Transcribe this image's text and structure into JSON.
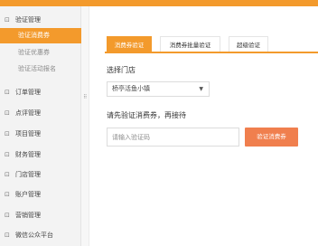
{
  "sidebar": {
    "groups": [
      {
        "icon": "collapse-icon",
        "label": "验证管理",
        "subitems": [
          {
            "label": "验证消费券",
            "active": true
          },
          {
            "label": "验证优惠券",
            "active": false
          },
          {
            "label": "验证活动报名",
            "active": false
          }
        ]
      },
      {
        "icon": "expand-icon",
        "label": "订单管理"
      },
      {
        "icon": "expand-icon",
        "label": "点评管理"
      },
      {
        "icon": "expand-icon",
        "label": "项目管理"
      },
      {
        "icon": "expand-icon",
        "label": "财务管理"
      },
      {
        "icon": "expand-icon",
        "label": "门店管理"
      },
      {
        "icon": "expand-icon",
        "label": "账户管理"
      },
      {
        "icon": "expand-icon",
        "label": "营销管理"
      },
      {
        "icon": "expand-icon",
        "label": "微信公众平台"
      }
    ]
  },
  "tabs": [
    {
      "label": "消费券验证",
      "active": true
    },
    {
      "label": "消费券批量验证",
      "active": false
    },
    {
      "label": "超级验证",
      "active": false
    }
  ],
  "form": {
    "store_label": "选择门店",
    "store_selected": "桥亭活鱼小镇",
    "code_label": "请先验证消费券，再接待",
    "code_placeholder": "请输入验证码",
    "verify_button": "验证消费券"
  },
  "colors": {
    "accent": "#f39a2c",
    "button": "#f07f4e"
  }
}
